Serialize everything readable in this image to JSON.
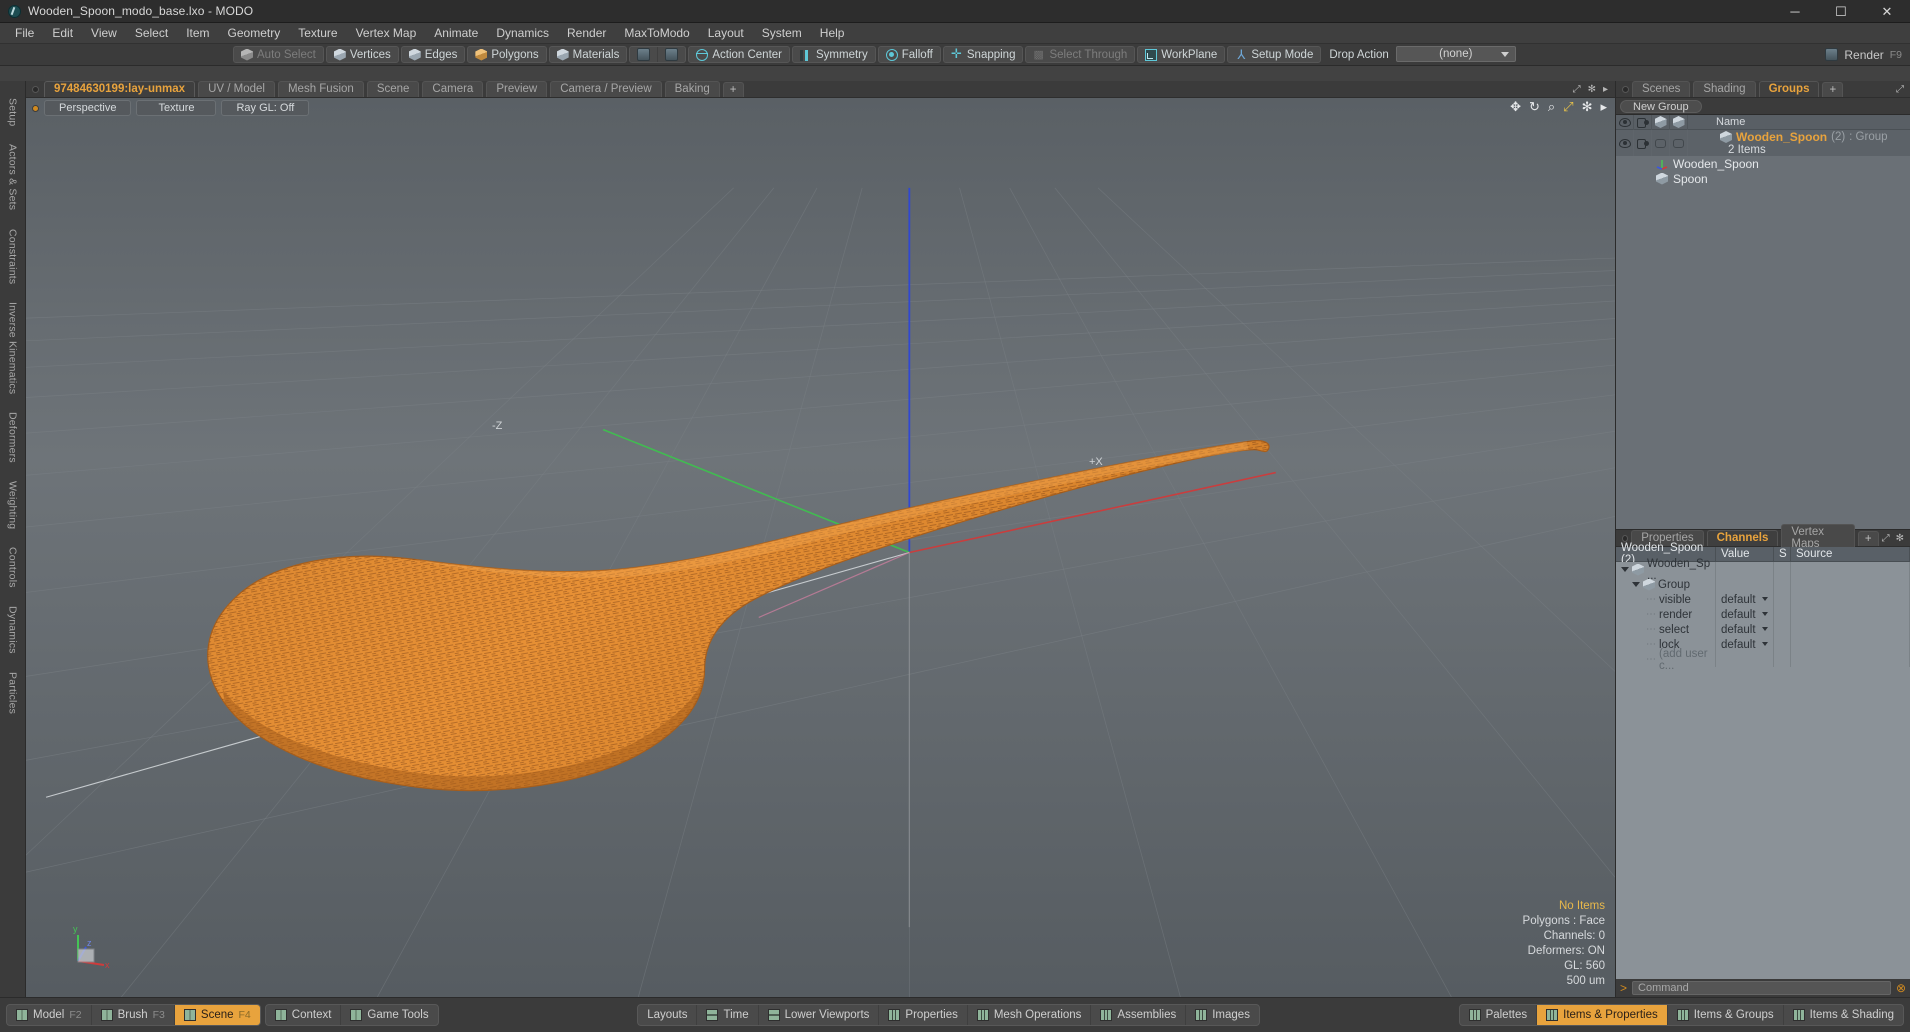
{
  "window": {
    "title": "Wooden_Spoon_modo_base.lxo - MODO",
    "app_icon": "modo-icon",
    "minimize": "─",
    "maximize": "☐",
    "close": "✕"
  },
  "menubar": {
    "items": [
      "File",
      "Edit",
      "View",
      "Select",
      "Item",
      "Geometry",
      "Texture",
      "Vertex Map",
      "Animate",
      "Dynamics",
      "Render",
      "MaxToModo",
      "Layout",
      "System",
      "Help"
    ]
  },
  "toolbar": {
    "selection_modes": [
      {
        "label": "Auto Select",
        "icon": "cube-grey-icon",
        "dim": true
      },
      {
        "label": "Vertices",
        "icon": "cube-icon",
        "dim": false
      },
      {
        "label": "Edges",
        "icon": "cube-icon",
        "dim": false
      },
      {
        "label": "Polygons",
        "icon": "cube-gold-icon",
        "dim": false
      },
      {
        "label": "Materials",
        "icon": "cube-icon",
        "dim": false
      }
    ],
    "mode_icons": [
      "select-box-icon",
      "select-lasso-icon"
    ],
    "action_center": {
      "label": "Action Center",
      "icon": "globe-icon"
    },
    "symmetry": {
      "label": "Symmetry",
      "icon": "symmetry-icon"
    },
    "falloff": {
      "label": "Falloff",
      "icon": "falloff-icon"
    },
    "snapping": {
      "label": "Snapping",
      "icon": "snapping-icon"
    },
    "select_through": {
      "label": "Select Through",
      "icon": "select-through-icon"
    },
    "workplane": {
      "label": "WorkPlane",
      "icon": "workplane-icon"
    },
    "setup_mode": {
      "label": "Setup Mode",
      "icon": "setup-mode-icon"
    },
    "drop_action_label": "Drop Action",
    "drop_action_value": "(none)",
    "render": {
      "label": "Render",
      "shortcut": "F9",
      "icon": "render-icon"
    }
  },
  "left_strip": {
    "tabs": [
      "Setup",
      "Actors & Sets",
      "Constraints",
      "Inverse Kinematics",
      "Deformers",
      "Weighting",
      "Controls",
      "Dynamics",
      "Particles"
    ]
  },
  "center": {
    "tabs": [
      {
        "label": "97484630199:lay-unmax",
        "active": true
      },
      {
        "label": "UV / Model",
        "active": false
      },
      {
        "label": "Mesh Fusion",
        "active": false
      },
      {
        "label": "Scene",
        "active": false
      },
      {
        "label": "Camera",
        "active": false
      },
      {
        "label": "Preview",
        "active": false
      },
      {
        "label": "Camera / Preview",
        "active": false
      },
      {
        "label": "Baking",
        "active": false
      },
      {
        "label": "+",
        "active": false
      }
    ],
    "viewport": {
      "view_mode": "Perspective",
      "shading_mode": "Texture",
      "raygl": "Ray GL: Off",
      "tool_icons": [
        "move-icon",
        "rotate-icon",
        "zoom-icon",
        "fit-icon",
        "gear-icon",
        "chevron-right-icon"
      ],
      "axis_labels": {
        "x": "+X",
        "z": "-Z",
        "gizmo_y": "y",
        "gizmo_x": "x",
        "gizmo_z": "z"
      },
      "stats": {
        "items": "No Items",
        "polygons": "Polygons : Face",
        "channels": "Channels: 0",
        "deformers": "Deformers: ON",
        "gl": "GL: 560",
        "scale": "500 um"
      }
    }
  },
  "right_panel": {
    "tabs": [
      {
        "label": "Scenes",
        "active": false
      },
      {
        "label": "Shading",
        "active": false
      },
      {
        "label": "Groups",
        "active": true
      },
      {
        "label": "+",
        "active": false
      }
    ],
    "new_group_button": "New Group",
    "list_columns": {
      "visible_icon": "eye-icon",
      "render_icon": "camera-icon",
      "col3_icon": "cube-outline-icon",
      "col4_icon": "cube-outline-icon",
      "name": "Name"
    },
    "group_row": {
      "icon": "group-cube-icon",
      "name": "Wooden_Spoon",
      "count": "(2)",
      "type": ": Group",
      "sub": "2 Items"
    },
    "children": [
      {
        "label": "Wooden_Spoon",
        "icon": "locator-icon"
      },
      {
        "label": "Spoon",
        "icon": "mesh-cube-icon"
      }
    ]
  },
  "props_panel": {
    "tabs": [
      {
        "label": "Properties",
        "active": false
      },
      {
        "label": "Channels",
        "active": true
      },
      {
        "label": "Vertex Maps",
        "active": false
      },
      {
        "label": "+",
        "active": false
      }
    ],
    "columns": [
      "Wooden_Spoon (2)",
      "Value",
      "S",
      "Source"
    ],
    "tree": [
      {
        "label": "Wooden_Sp ...",
        "depth": 0,
        "icon": "cube-icon",
        "expander": "down"
      },
      {
        "label": "Group",
        "depth": 1,
        "icon": "cube-icon",
        "expander": "down"
      }
    ],
    "channels": [
      {
        "name": "visible",
        "value": "default"
      },
      {
        "name": "render",
        "value": "default"
      },
      {
        "name": "select",
        "value": "default"
      },
      {
        "name": "lock",
        "value": "default"
      }
    ],
    "add_user": "(add user c...",
    "command_label": "Command",
    "command_placeholder": ""
  },
  "bottom_bar": {
    "left_groups": [
      [
        {
          "label": "Model",
          "fkey": "F2",
          "swatch": "two",
          "active": false
        },
        {
          "label": "Brush",
          "fkey": "F3",
          "swatch": "two",
          "active": false
        },
        {
          "label": "Scene",
          "fkey": "F4",
          "swatch": "two",
          "active": true
        }
      ],
      [
        {
          "label": "Context",
          "fkey": "",
          "swatch": "two",
          "active": false
        },
        {
          "label": "Game Tools",
          "fkey": "",
          "swatch": "two",
          "active": false
        }
      ]
    ],
    "center_group": [
      {
        "label": "Layouts",
        "swatch": "none"
      },
      {
        "label": "Time",
        "swatch": "hbar"
      },
      {
        "label": "Lower Viewports",
        "swatch": "hbar"
      },
      {
        "label": "Properties",
        "swatch": "three"
      },
      {
        "label": "Mesh Operations",
        "swatch": "three"
      },
      {
        "label": "Assemblies",
        "swatch": "three"
      },
      {
        "label": "Images",
        "swatch": "three"
      }
    ],
    "right_group": [
      {
        "label": "Palettes",
        "swatch": "three",
        "active": false
      },
      {
        "label": "Items & Properties",
        "swatch": "three",
        "active": true
      },
      {
        "label": "Items & Groups",
        "swatch": "three",
        "active": false
      },
      {
        "label": "Items & Shading",
        "swatch": "three",
        "active": false
      }
    ]
  },
  "colors": {
    "accent_orange": "#e8a33d",
    "panel_bg": "#3b3b3b",
    "viewport_bg": "#6c7277",
    "model_orange": "#e08a2e",
    "cyan": "#5ec8d8"
  }
}
